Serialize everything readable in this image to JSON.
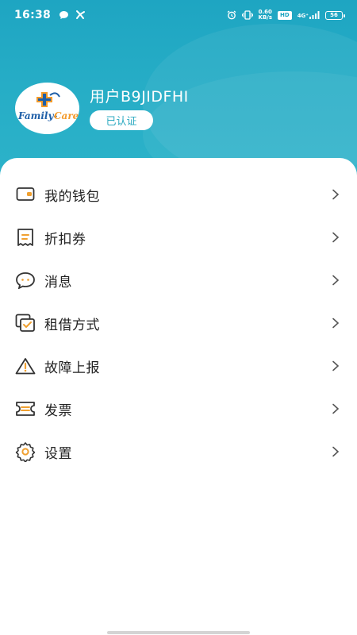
{
  "status_bar": {
    "time": "16:38",
    "speed_value": "0.60",
    "speed_unit": "KB/s",
    "hd": "HD",
    "network": "4G⁺",
    "battery": "56"
  },
  "profile": {
    "avatar_text": "Family-Care",
    "username": "用户B9JIDFHI",
    "verified_label": "已认证"
  },
  "menu": {
    "items": [
      {
        "label": "我的钱包",
        "icon": "wallet-icon"
      },
      {
        "label": "折扣券",
        "icon": "coupon-icon"
      },
      {
        "label": "消息",
        "icon": "message-icon"
      },
      {
        "label": "租借方式",
        "icon": "rental-method-icon"
      },
      {
        "label": "故障上报",
        "icon": "warning-icon"
      },
      {
        "label": "发票",
        "icon": "invoice-icon"
      },
      {
        "label": "设置",
        "icon": "gear-icon"
      }
    ]
  },
  "colors": {
    "header": "#1ea5c2",
    "accent_orange": "#f0a030",
    "icon_dark": "#333333"
  }
}
